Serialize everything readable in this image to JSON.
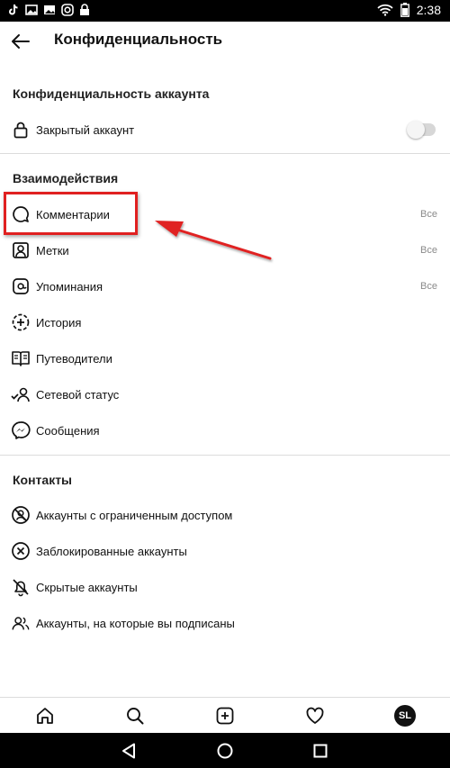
{
  "status_bar": {
    "time": "2:38"
  },
  "header": {
    "title": "Конфиденциальность"
  },
  "sections": {
    "account": {
      "title": "Конфиденциальность аккаунта",
      "private_account": {
        "label": "Закрытый аккаунт",
        "enabled": false
      }
    },
    "interactions": {
      "title": "Взаимодействия",
      "items": [
        {
          "label": "Комментарии",
          "value": "Все",
          "icon": "comment-icon"
        },
        {
          "label": "Метки",
          "value": "Все",
          "icon": "tag-person-icon"
        },
        {
          "label": "Упоминания",
          "value": "Все",
          "icon": "at-sign-icon"
        },
        {
          "label": "История",
          "value": "",
          "icon": "story-plus-icon"
        },
        {
          "label": "Путеводители",
          "value": "",
          "icon": "guide-book-icon"
        },
        {
          "label": "Сетевой статус",
          "value": "",
          "icon": "activity-status-icon"
        },
        {
          "label": "Сообщения",
          "value": "",
          "icon": "messenger-icon"
        }
      ]
    },
    "contacts": {
      "title": "Контакты",
      "items": [
        {
          "label": "Аккаунты с ограниченным доступом",
          "icon": "restricted-icon"
        },
        {
          "label": "Заблокированные аккаунты",
          "icon": "blocked-icon"
        },
        {
          "label": "Скрытые аккаунты",
          "icon": "muted-bell-icon"
        },
        {
          "label": "Аккаунты, на которые вы подписаны",
          "icon": "following-people-icon"
        }
      ]
    }
  },
  "bottom_nav": {
    "tabs": [
      "home-icon",
      "search-icon",
      "new-post-icon",
      "activity-heart-icon",
      "profile-avatar"
    ],
    "avatar_initials": "SL"
  },
  "android_nav": [
    "back-triangle-icon",
    "home-circle-icon",
    "recents-square-icon"
  ],
  "annotation": {
    "color": "#e02020",
    "target": "Комментарии"
  }
}
